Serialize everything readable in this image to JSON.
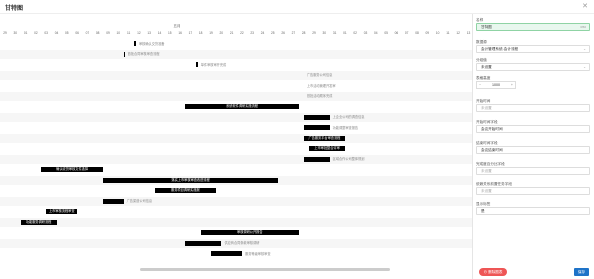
{
  "window": {
    "title": "甘特图",
    "close_icon": "close-icon"
  },
  "gantt": {
    "month": "五月",
    "days": [
      "29",
      "30",
      "01",
      "02",
      "03",
      "04",
      "05",
      "06",
      "07",
      "08",
      "09",
      "10",
      "11",
      "12",
      "13",
      "14",
      "15",
      "16",
      "17",
      "18",
      "19",
      "20",
      "21",
      "22",
      "23",
      "24",
      "25",
      "26",
      "27",
      "28",
      "29",
      "30",
      "31",
      "01",
      "02",
      "03",
      "04",
      "05",
      "06",
      "07",
      "08",
      "09",
      "10",
      "11",
      "12",
      "13"
    ],
    "tasks": [
      {
        "label": "审核确认交货准备",
        "style": "outline",
        "start": 13,
        "span": 0.2
      },
      {
        "label": "首批合同审核审查流程",
        "style": "outline",
        "start": 12,
        "span": 0.1
      },
      {
        "label": "单件审核审开完成",
        "style": "outline",
        "start": 19,
        "span": 0.2
      },
      {
        "label": "广告服务公司信息",
        "style": "outline",
        "start": 29.5,
        "span": 0
      },
      {
        "label": "上市活动管理开发审",
        "style": "outline",
        "start": 29.5,
        "span": 0
      },
      {
        "label": "首批活动顺序完成",
        "style": "outline",
        "start": 29.5,
        "span": 0
      },
      {
        "label": "系统软件调研实施流程",
        "style": "filled",
        "start": 18,
        "span": 11
      },
      {
        "label": "上企业公司的调查信息",
        "style": "after",
        "start": 29.5,
        "span": 2.5
      },
      {
        "label": "功能调整审查报告",
        "style": "after",
        "start": 29.5,
        "span": 2.5
      },
      {
        "label": "广告服务平台审查流程",
        "style": "filled",
        "start": 29.5,
        "span": 4
      },
      {
        "label": "上市审批整合评审",
        "style": "filled",
        "start": 30,
        "span": 3.5
      },
      {
        "label": "区域合作公司整体规划",
        "style": "after",
        "start": 29.5,
        "span": 2.5
      },
      {
        "label": "确认收货审核文件选择",
        "style": "filled",
        "start": 4,
        "span": 6
      },
      {
        "label": "落实上市审核审查改进流程",
        "style": "filled",
        "start": 10,
        "span": 17
      },
      {
        "label": "服务项目调研实施报",
        "style": "filled",
        "start": 15,
        "span": 6
      },
      {
        "label": "广告渠道公司信息",
        "style": "after",
        "start": 10,
        "span": 2
      },
      {
        "label": "上市审核流程审查",
        "style": "filled",
        "start": 4.5,
        "span": 3
      },
      {
        "label": "功能服务调研流程",
        "style": "filled",
        "start": 2,
        "span": 3.5
      },
      {
        "label": "审核调研公开报告",
        "style": "filled",
        "start": 19.5,
        "span": 9.5
      },
      {
        "label": "供应商合同条款审核调研",
        "style": "after",
        "start": 18,
        "span": 3.5
      },
      {
        "label": "服务等级审核审查",
        "style": "after",
        "start": 20.5,
        "span": 3
      }
    ]
  },
  "panel": {
    "name_label": "名称",
    "name_value": "甘特图",
    "name_count": "3/50",
    "datasource_label": "数据源",
    "datasource_value": "会计管理系统-会计流程",
    "group_label": "分组值",
    "group_value": "未设置",
    "height_label": "表格高度",
    "height_value": "1000",
    "start_label": "开始时间",
    "start_placeholder": "未设置",
    "start_field_label": "开始时间字段",
    "start_field_value": "会议开始时间",
    "end_field_label": "结束时间字段",
    "end_field_value": "会议结束时间",
    "progress_label": "完成度百分比字段",
    "progress_placeholder": "未设置",
    "related_label": "依赖关系前置任务字段",
    "related_placeholder": "未设置",
    "show_label": "显示标签",
    "show_value": "是"
  },
  "footer": {
    "delete_label": "删除图表",
    "save_label": "保存"
  }
}
